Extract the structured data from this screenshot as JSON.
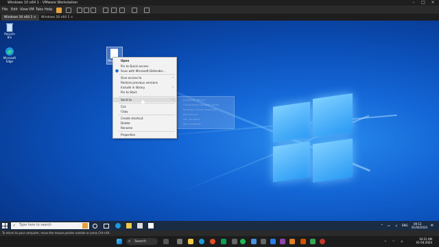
{
  "vmware": {
    "window_title": "Windows 10 x64 1 - VMware Workstation",
    "menu": [
      "File",
      "Edit",
      "View",
      "VM",
      "Tabs",
      "Help"
    ],
    "tabs": [
      {
        "label": "Windows 10 x64 1",
        "active": true
      },
      {
        "label": "Windows 10 x64 1",
        "active": false
      }
    ],
    "status_text": "To return to your computer, move the mouse pointer outside or press Ctrl+Alt."
  },
  "desktop": {
    "icons": [
      {
        "label": "Recycle Bin",
        "icon": "recycle-bin-icon"
      },
      {
        "label": "Microsoft Edge",
        "icon": "edge-icon"
      }
    ],
    "selected_file_label": "New..."
  },
  "context_menu": {
    "items": [
      {
        "label": "Open",
        "bold": true
      },
      {
        "label": "Pin to Quick access"
      },
      {
        "label": "Scan with Microsoft Defender...",
        "icon": "defender-icon"
      },
      {
        "label": "Give access to",
        "submenu": true
      },
      {
        "label": "Restore previous versions"
      },
      {
        "label": "Include in library",
        "submenu": true
      },
      {
        "label": "Pin to Start"
      },
      {
        "label": "Send to",
        "submenu": true,
        "highlighted": true
      },
      {
        "label": "Cut"
      },
      {
        "label": "Copy"
      },
      {
        "label": "Create shortcut"
      },
      {
        "label": "Delete"
      },
      {
        "label": "Rename"
      },
      {
        "label": "Properties"
      }
    ],
    "submenu_items": [
      "Bluetooth device",
      "Compressed (zipped) folder",
      "Desktop (create shortcut)",
      "Documents",
      "Fax recipient",
      "Mail recipient"
    ]
  },
  "guest_taskbar": {
    "search_placeholder": "Type here to search",
    "tray_lang": "ENG",
    "time": "09:12",
    "date": "01/04/2024"
  },
  "host_taskbar": {
    "search_label": "Search",
    "time": "10:21 AM",
    "date": "01-04-2024"
  },
  "colors": {
    "desktop_blue": "#0b4fb8",
    "menu_bg": "#f2f2f2",
    "host_taskbar": "#1c1c1c"
  }
}
